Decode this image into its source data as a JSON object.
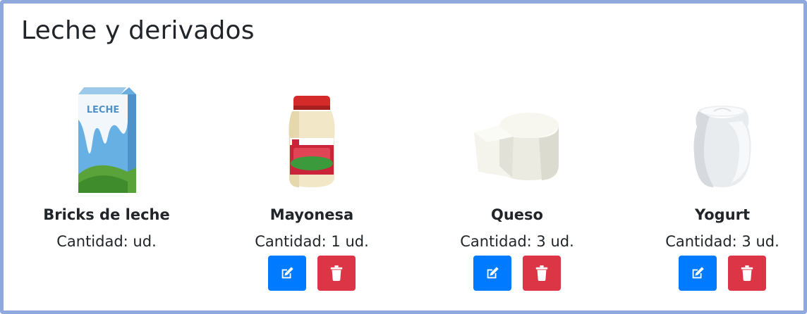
{
  "section": {
    "title": "Leche y derivados"
  },
  "products": [
    {
      "name": "Bricks de leche",
      "quantity": "Cantidad: ud.",
      "image": "milk-carton-image",
      "has_actions": false,
      "brand_text": "LECHE"
    },
    {
      "name": "Mayonesa",
      "quantity": "Cantidad: 1 ud.",
      "image": "mayonnaise-jar-image",
      "has_actions": true
    },
    {
      "name": "Queso",
      "quantity": "Cantidad: 3 ud.",
      "image": "cheese-wheel-image",
      "has_actions": true
    },
    {
      "name": "Yogurt",
      "quantity": "Cantidad: 3 ud.",
      "image": "yogurt-jar-image",
      "has_actions": true
    }
  ],
  "actions": {
    "edit_icon": "edit-icon",
    "delete_icon": "trash-icon"
  },
  "colors": {
    "border": "#8fa8dd",
    "edit": "#007bff",
    "delete": "#dc3545",
    "text": "#212529"
  }
}
